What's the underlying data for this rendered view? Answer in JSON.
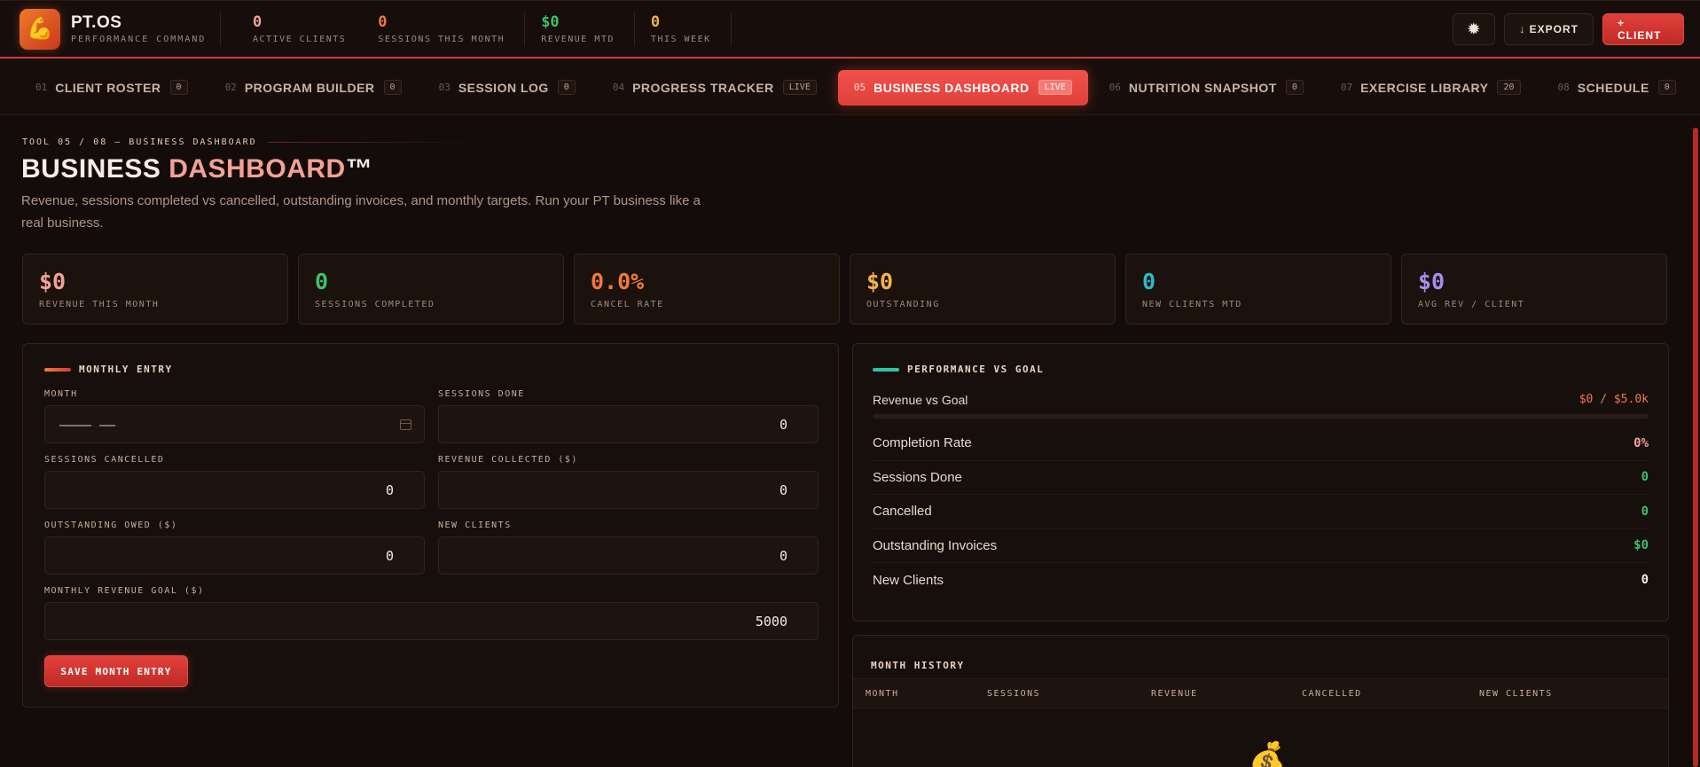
{
  "app": {
    "name": "PT.OS",
    "subtitle": "PERFORMANCE COMMAND",
    "logo_icon": "flexed-bicep-icon"
  },
  "header_stats": [
    {
      "value": "0",
      "label": "ACTIVE CLIENTS",
      "color": "#f2a294"
    },
    {
      "value": "0",
      "label": "SESSIONS THIS MONTH",
      "color": "#f07a3a"
    },
    {
      "value": "$0",
      "label": "REVENUE MTD",
      "color": "#3fbf6a"
    },
    {
      "value": "0",
      "label": "THIS WEEK",
      "color": "#f2b447"
    }
  ],
  "header_actions": {
    "theme_icon": "✹",
    "export_label": "↓ EXPORT",
    "client_label": "+ CLIENT"
  },
  "tabs": [
    {
      "num": "01",
      "label": "CLIENT ROSTER",
      "badge": "0"
    },
    {
      "num": "02",
      "label": "PROGRAM BUILDER",
      "badge": "0"
    },
    {
      "num": "03",
      "label": "SESSION LOG",
      "badge": "0"
    },
    {
      "num": "04",
      "label": "PROGRESS TRACKER",
      "badge": "LIVE"
    },
    {
      "num": "05",
      "label": "BUSINESS DASHBOARD",
      "badge": "LIVE"
    },
    {
      "num": "06",
      "label": "NUTRITION SNAPSHOT",
      "badge": "0"
    },
    {
      "num": "07",
      "label": "EXERCISE LIBRARY",
      "badge": "20"
    },
    {
      "num": "08",
      "label": "SCHEDULE",
      "badge": "0"
    }
  ],
  "active_tab": 4,
  "page": {
    "crumb": "TOOL 05 / 08 — BUSINESS DASHBOARD",
    "title_main": "BUSINESS ",
    "title_accent": "DASHBOARD",
    "title_mark": "™",
    "description": "Revenue, sessions completed vs cancelled, outstanding invoices, and monthly targets. Run your PT business like a real business."
  },
  "kpis": [
    {
      "value": "$0",
      "label": "REVENUE THIS MONTH",
      "color": "#f2a294"
    },
    {
      "value": "0",
      "label": "SESSIONS COMPLETED",
      "color": "#3fbf6a"
    },
    {
      "value": "0.0%",
      "label": "CANCEL RATE",
      "color": "#f07a3a"
    },
    {
      "value": "$0",
      "label": "OUTSTANDING",
      "color": "#f2b447"
    },
    {
      "value": "0",
      "label": "NEW CLIENTS MTD",
      "color": "#2fb8c9"
    },
    {
      "value": "$0",
      "label": "AVG REV / CLIENT",
      "color": "#a98cf0"
    }
  ],
  "entry": {
    "title": "MONTHLY ENTRY",
    "month_label": "MONTH",
    "month_value": "———— ——",
    "sessions_done_label": "SESSIONS DONE",
    "sessions_done_value": "0",
    "sessions_cancelled_label": "SESSIONS CANCELLED",
    "sessions_cancelled_value": "0",
    "revenue_label": "REVENUE COLLECTED ($)",
    "revenue_value": "0",
    "outstanding_label": "OUTSTANDING OWED ($)",
    "outstanding_value": "0",
    "new_clients_label": "NEW CLIENTS",
    "new_clients_value": "0",
    "goal_label": "MONTHLY REVENUE GOAL ($)",
    "goal_value": "5000",
    "save_label": "SAVE MONTH ENTRY"
  },
  "goal": {
    "title": "PERFORMANCE VS GOAL",
    "revenue_label": "Revenue vs Goal",
    "revenue_value": "$0 / $5.0k",
    "progress_fraction": 0,
    "rows": [
      {
        "label": "Completion Rate",
        "value": "0%",
        "color": "#f2a294"
      },
      {
        "label": "Sessions Done",
        "value": "0",
        "color": "#3fbf6a"
      },
      {
        "label": "Cancelled",
        "value": "0",
        "color": "#3fbf6a"
      },
      {
        "label": "Outstanding Invoices",
        "value": "$0",
        "color": "#3fbf6a"
      },
      {
        "label": "New Clients",
        "value": "0",
        "color": "#f4ece4"
      }
    ]
  },
  "history": {
    "title": "MONTH HISTORY",
    "columns": [
      "MONTH",
      "SESSIONS",
      "REVENUE",
      "CANCELLED",
      "NEW CLIENTS"
    ],
    "empty_icon": "money-bag-icon"
  }
}
